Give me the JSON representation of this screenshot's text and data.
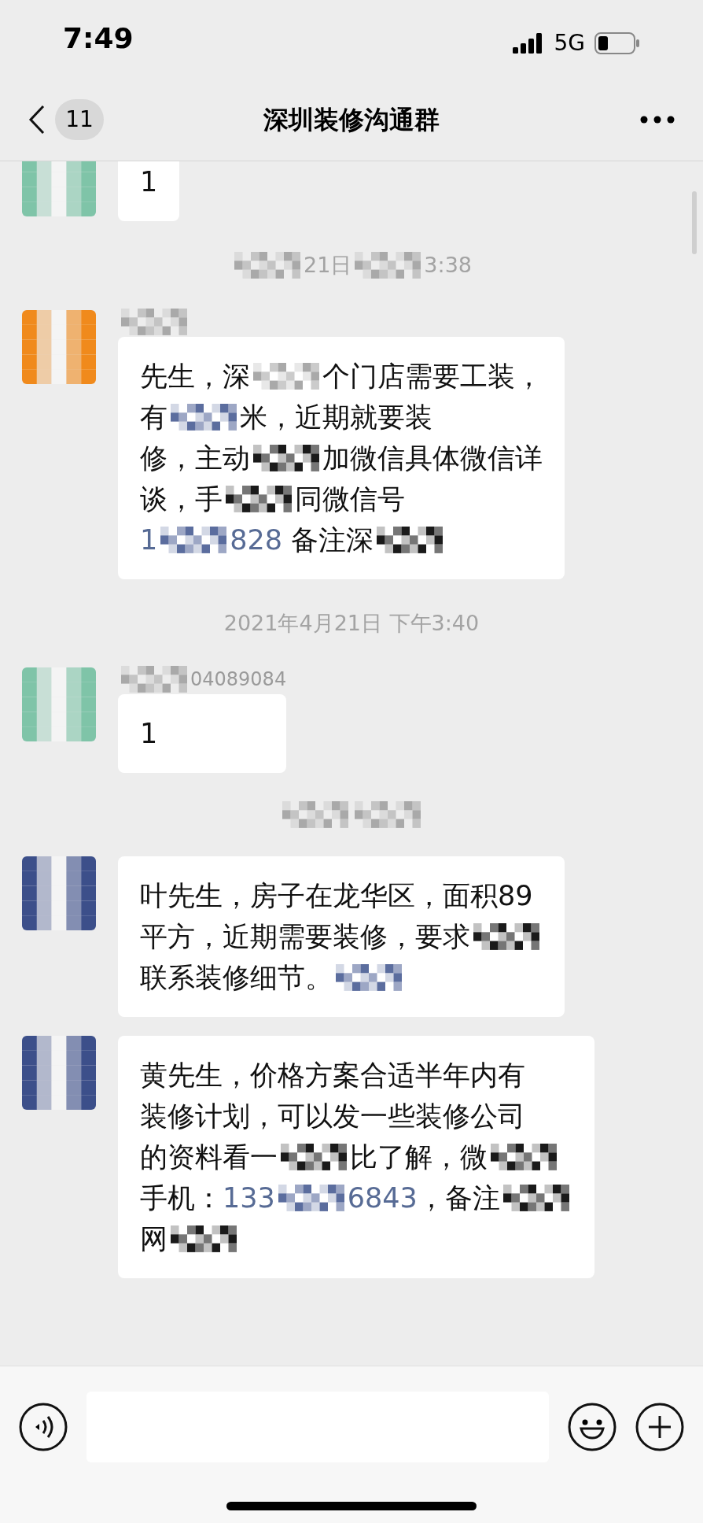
{
  "status_bar": {
    "time": "7:49",
    "network": "5G"
  },
  "nav": {
    "badge": "11",
    "title": "深圳装修沟通群"
  },
  "messages": [
    {
      "kind": "bubble",
      "color": "#7fc4a8",
      "lines": [
        [
          {
            "kind": "text",
            "text": "1"
          }
        ]
      ]
    },
    {
      "kind": "time",
      "parts": [
        {
          "kind": "mosaic",
          "color": "#a9a9a9"
        },
        {
          "kind": "text",
          "text": "21日"
        },
        {
          "kind": "mosaic",
          "color": "#a9a9a9"
        },
        {
          "kind": "text",
          "text": "3:38"
        }
      ]
    },
    {
      "kind": "bubble",
      "color": "#f08a1c",
      "sender": [
        {
          "kind": "mosaic",
          "color": "#a9a9a9"
        }
      ],
      "lines": [
        [
          {
            "kind": "text",
            "text": "先生，深"
          },
          {
            "kind": "mosaic",
            "color": "#a9a9a9"
          },
          {
            "kind": "text",
            "text": "个门店需要工装，"
          }
        ],
        [
          {
            "kind": "text",
            "text": "有"
          },
          {
            "kind": "mosaic",
            "color": "#5b6d9e"
          },
          {
            "kind": "text",
            "text": "米，近期就要装"
          }
        ],
        [
          {
            "kind": "text",
            "text": "修，主动"
          },
          {
            "kind": "mosaic",
            "color": "#1a1a1a"
          },
          {
            "kind": "text",
            "text": "加微信具体微信详"
          }
        ],
        [
          {
            "kind": "text",
            "text": "谈，手"
          },
          {
            "kind": "mosaic",
            "color": "#1a1a1a"
          },
          {
            "kind": "text",
            "text": "同微信号"
          }
        ],
        [
          {
            "kind": "link",
            "text": "1"
          },
          {
            "kind": "mosaic",
            "color": "#5b6d9e"
          },
          {
            "kind": "link",
            "text": "828"
          },
          {
            "kind": "text",
            "text": " 备注深"
          },
          {
            "kind": "mosaic",
            "color": "#1a1a1a"
          }
        ]
      ]
    },
    {
      "kind": "time",
      "parts": [
        {
          "kind": "text",
          "text": "2021年4月21日 下午3:40"
        }
      ]
    },
    {
      "kind": "bubble",
      "color": "#7fc4a8",
      "sender": [
        {
          "kind": "mosaic",
          "color": "#a9a9a9"
        },
        {
          "kind": "text",
          "text": "04089084"
        }
      ],
      "lines": [
        [
          {
            "kind": "text",
            "text": "1"
          }
        ]
      ]
    },
    {
      "kind": "time",
      "parts": [
        {
          "kind": "mosaic",
          "color": "#a9a9a9"
        },
        {
          "kind": "mosaic",
          "color": "#a9a9a9"
        }
      ]
    },
    {
      "kind": "bubble",
      "color": "#3c4f8a",
      "lines": [
        [
          {
            "kind": "text",
            "text": "叶先生，房子在龙华区，面积89"
          }
        ],
        [
          {
            "kind": "text",
            "text": "平方，近期需要装修，要求"
          },
          {
            "kind": "mosaic",
            "color": "#1a1a1a"
          }
        ],
        [
          {
            "kind": "text",
            "text": "联系装修细节。"
          },
          {
            "kind": "mosaic",
            "color": "#5b6d9e"
          }
        ]
      ]
    },
    {
      "kind": "bubble",
      "color": "#3c4f8a",
      "lines": [
        [
          {
            "kind": "text",
            "text": "黄先生，价格方案合适半年内有"
          }
        ],
        [
          {
            "kind": "text",
            "text": "装修计划，可以发一些装修公司"
          }
        ],
        [
          {
            "kind": "text",
            "text": "的资料看一"
          },
          {
            "kind": "mosaic",
            "color": "#1a1a1a"
          },
          {
            "kind": "text",
            "text": "比了解，微"
          },
          {
            "kind": "mosaic",
            "color": "#1a1a1a"
          }
        ],
        [
          {
            "kind": "text",
            "text": "手机："
          },
          {
            "kind": "link",
            "text": "133"
          },
          {
            "kind": "mosaic",
            "color": "#5b6d9e"
          },
          {
            "kind": "link",
            "text": "6843"
          },
          {
            "kind": "text",
            "text": "，备注"
          },
          {
            "kind": "mosaic",
            "color": "#1a1a1a"
          }
        ],
        [
          {
            "kind": "text",
            "text": "网"
          },
          {
            "kind": "mosaic",
            "color": "#1a1a1a"
          }
        ]
      ]
    }
  ]
}
